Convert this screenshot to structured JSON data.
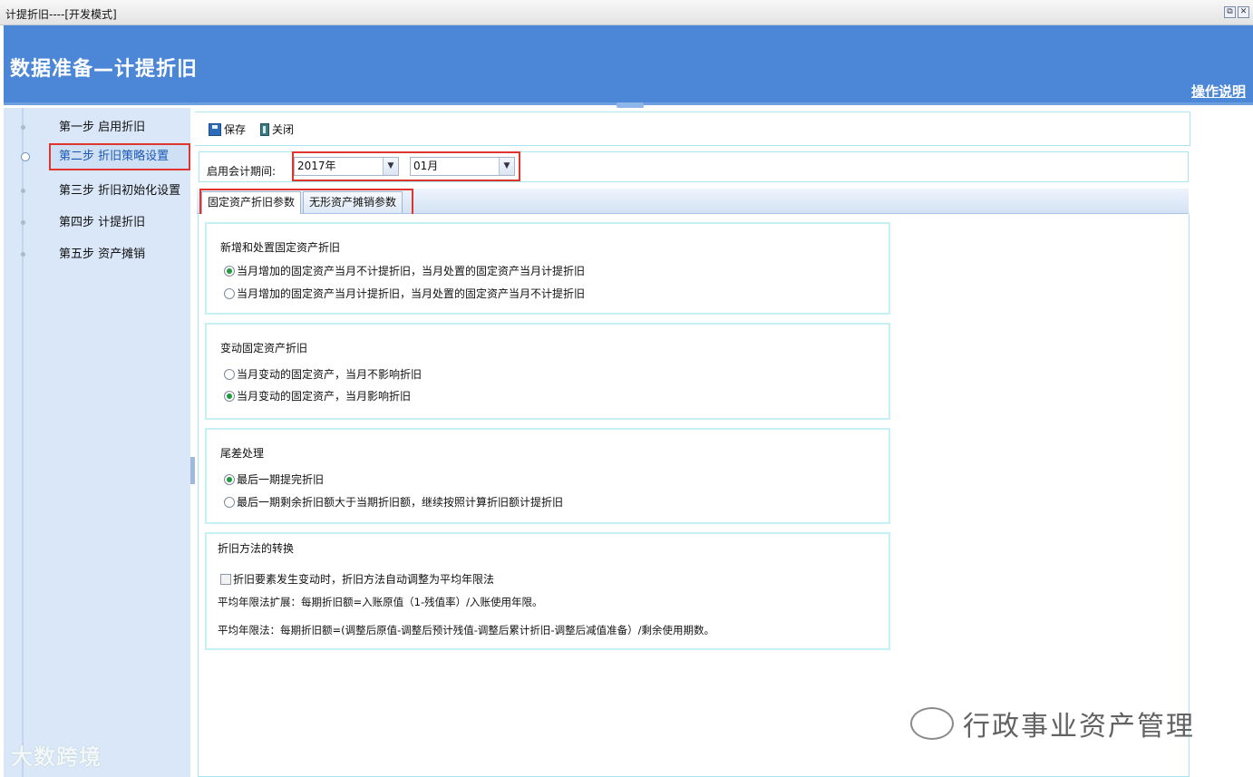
{
  "window": {
    "title": "计提折旧----[开发模式]",
    "restore_glyph": "⧉",
    "close_glyph": "✕"
  },
  "banner": {
    "title": "数据准备—计提折旧",
    "help_link": "操作说明",
    "background_color": "#4c86d6"
  },
  "sidebar": {
    "steps": [
      {
        "label": "第一步 启用折旧",
        "active": false
      },
      {
        "label": "第二步 折旧策略设置",
        "active": true
      },
      {
        "label": "第三步 折旧初始化设置",
        "active": false
      },
      {
        "label": "第四步 计提折旧",
        "active": false
      },
      {
        "label": "第五步 资产摊销",
        "active": false
      }
    ]
  },
  "toolbar": {
    "save_label": "保存",
    "close_label": "关闭",
    "save_icon": "save-icon",
    "close_icon": "door-exit-icon"
  },
  "period": {
    "label": "启用会计期间:",
    "year_value": "2017年",
    "month_value": "01月",
    "arrow_glyph": "▼"
  },
  "tabs": [
    {
      "label": "固定资产折旧参数",
      "active": true
    },
    {
      "label": "无形资产摊销参数",
      "active": false
    }
  ],
  "groups": {
    "new_disposal": {
      "title": "新增和处置固定资产折旧",
      "options": [
        {
          "label": "当月增加的固定资产当月不计提折旧，当月处置的固定资产当月计提折旧",
          "checked": true
        },
        {
          "label": "当月增加的固定资产当月计提折旧，当月处置的固定资产当月不计提折旧",
          "checked": false
        }
      ]
    },
    "change": {
      "title": "变动固定资产折旧",
      "options": [
        {
          "label": "当月变动的固定资产，当月不影响折旧",
          "checked": false
        },
        {
          "label": "当月变动的固定资产，当月影响折旧",
          "checked": true
        }
      ]
    },
    "rounding": {
      "title": "尾差处理",
      "options": [
        {
          "label": "最后一期提完折旧",
          "checked": true
        },
        {
          "label": "最后一期剩余折旧额大于当期折旧额，继续按照计算折旧额计提折旧",
          "checked": false
        }
      ]
    },
    "method": {
      "title": "折旧方法的转换",
      "checkbox_label": "折旧要素发生变动时，折旧方法自动调整为平均年限法",
      "checkbox_checked": false,
      "note1": "平均年限法扩展：每期折旧额=入账原值（1-残值率）/入账使用年限。",
      "note2": "平均年限法：每期折旧额=(调整后原值-调整后预计残值-调整后累计折旧-调整后减值准备）/剩余使用期数。"
    }
  },
  "watermarks": {
    "left": "大数跨境",
    "right": "行政事业资产管理"
  },
  "colors": {
    "highlight_box": "#e0352f",
    "sidebar_bg": "#d9e7f8",
    "radio_checked": "#1f9a3c",
    "group_border": "#c4f0f6"
  }
}
